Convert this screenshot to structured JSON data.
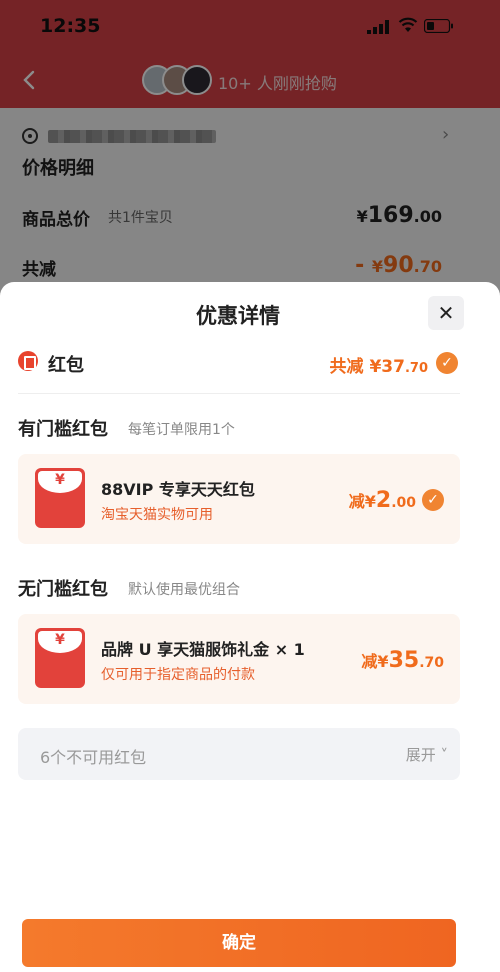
{
  "status_bar": {
    "time": "12:35"
  },
  "nav": {
    "buy_text": "10+ 人刚刚抢购"
  },
  "background": {
    "title": "价格明细",
    "rows": [
      {
        "label": "商品总价",
        "sub": "共1件宝贝",
        "prefix": "",
        "symbol": "¥",
        "int": "169",
        "dec": ".00"
      },
      {
        "label": "共减",
        "sub": "",
        "prefix": "- ",
        "symbol": "¥",
        "int": "90",
        "dec": ".70"
      }
    ]
  },
  "sheet": {
    "title": "优惠详情",
    "close": "✕",
    "hongbao": {
      "label": "红包",
      "prefix": "共减",
      "symbol": "¥",
      "int": "37",
      "dec": ".70"
    },
    "section1": {
      "title": "有门槛红包",
      "sub": "每笔订单限用1个"
    },
    "card1": {
      "yen": "¥",
      "title": "88VIP 专享天天红包",
      "sub": "淘宝天猫实物可用",
      "prefix": "减",
      "symbol": "¥",
      "int": "2",
      "dec": ".00"
    },
    "section2": {
      "title": "无门槛红包",
      "sub": "默认使用最优组合"
    },
    "card2": {
      "yen": "¥",
      "title": "品牌 U 享天猫服饰礼金 × 1",
      "sub": "仅可用于指定商品的付款",
      "prefix": "减",
      "symbol": "¥",
      "int": "35",
      "dec": ".70"
    },
    "unavailable": {
      "text": "6个不可用红包",
      "expand": "展开"
    },
    "confirm": "确定"
  },
  "colors": {
    "accent": "#f06b1c",
    "header_red": "#d64146",
    "check": "#f08431"
  }
}
